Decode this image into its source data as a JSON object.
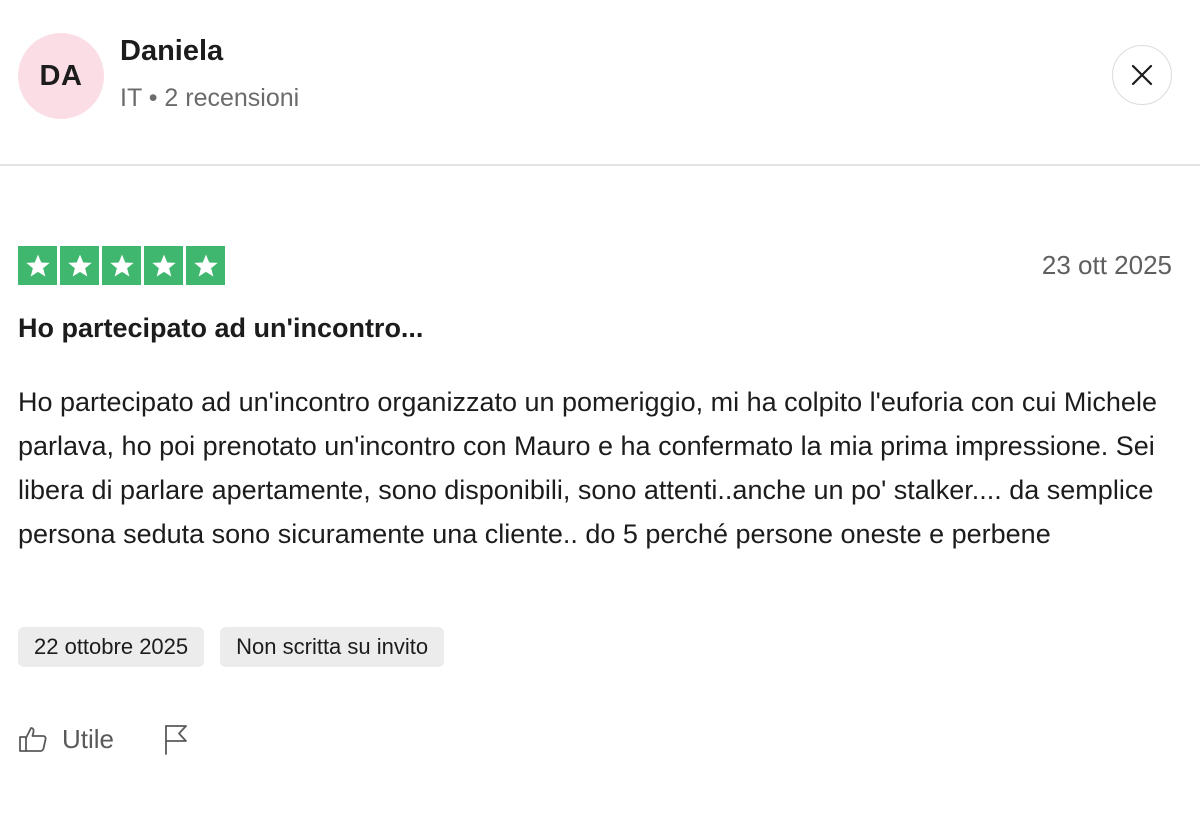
{
  "reviewer": {
    "initials": "DA",
    "name": "Daniela",
    "meta": "IT • 2 recensioni",
    "avatar_color": "#fbdde6"
  },
  "review": {
    "rating": 5,
    "rating_max": 5,
    "star_color": "#3fb76f",
    "date": "23 ott 2025",
    "title": "Ho partecipato ad un'incontro...",
    "body": "Ho partecipato ad un'incontro organizzato un pomeriggio, mi ha colpito l'euforia con cui Michele parlava, ho poi prenotato un'incontro con Mauro e ha confermato la mia prima impressione. Sei libera di parlare apertamente, sono disponibili, sono attenti..anche un po' stalker.... da semplice persona seduta sono sicuramente una cliente.. do 5 perché persone oneste e perbene",
    "experience_date": "22 ottobre 2025",
    "invite_status": "Non scritta su invito"
  },
  "actions": {
    "useful_label": "Utile",
    "useful_icon": "thumbs-up-icon",
    "flag_icon": "flag-icon",
    "close_icon": "close-icon"
  }
}
